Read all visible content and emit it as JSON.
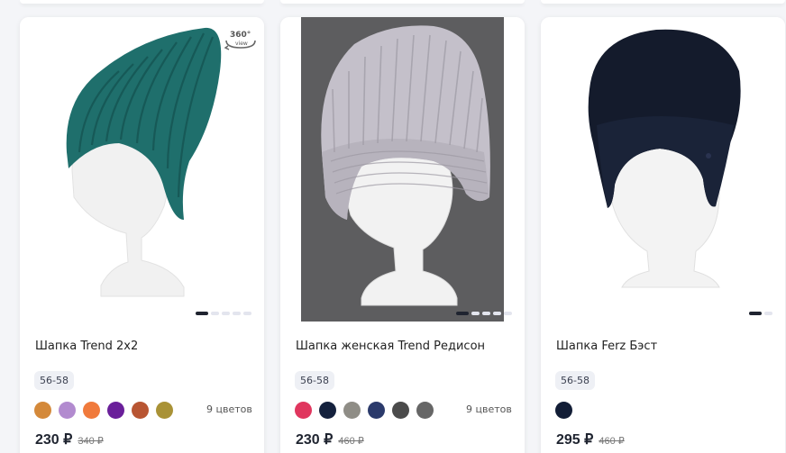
{
  "products": [
    {
      "title": "Шапка Trend 2x2",
      "size": "56-58",
      "swatches": [
        "#d4893a",
        "#b28bcf",
        "#f07a3c",
        "#6a1f9a",
        "#b85532",
        "#a99236"
      ],
      "colors_count": "9 цветов",
      "price": "230 ₽",
      "old_price": "340 ₽",
      "badge_360": "360°",
      "badge_view": "view",
      "slides": 5,
      "active_slide": 1,
      "hat_color": "#1f6f6c"
    },
    {
      "title": "Шапка женская Trend Редисон",
      "size": "56-58",
      "swatches": [
        "#e0365e",
        "#14213d",
        "#8f8d86",
        "#2b3a6b",
        "#4b4b4b",
        "#666666"
      ],
      "colors_count": "9 цветов",
      "price": "230 ₽",
      "old_price": "460 ₽",
      "slides": 5,
      "active_slide": 1,
      "hat_color": "#c4c0ca"
    },
    {
      "title": "Шапка Ferz Бэст",
      "size": "56-58",
      "swatches": [
        "#121d36"
      ],
      "price": "295 ₽",
      "old_price": "460 ₽",
      "slides": 2,
      "active_slide": 1,
      "hat_color": "#141b2c"
    }
  ]
}
